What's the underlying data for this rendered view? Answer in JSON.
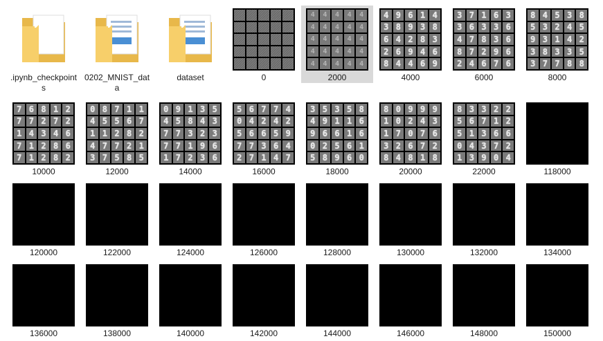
{
  "folders": [
    {
      "label": ".ipynb_checkpoints",
      "icon": "folder-icon"
    },
    {
      "label": "0202_MNIST_data",
      "icon": "folder-icon"
    },
    {
      "label": "dataset",
      "icon": "folder-icon"
    }
  ],
  "images": [
    {
      "label": "0",
      "kind": "noise"
    },
    {
      "label": "2000",
      "kind": "faint",
      "digits": "4444444444444444444444444",
      "selected": true
    },
    {
      "label": "4000",
      "kind": "digits",
      "digits": "4961438938642832694684469"
    },
    {
      "label": "6000",
      "kind": "digits",
      "digits": "3716336336478368729624676"
    },
    {
      "label": "8000",
      "kind": "digits",
      "digits": "8453853245931423833537788"
    },
    {
      "label": "10000",
      "kind": "digits",
      "digits": "7681277272143467128671282"
    },
    {
      "label": "12000",
      "kind": "digits",
      "digits": "0871145567112824772137585"
    },
    {
      "label": "14000",
      "kind": "digits",
      "digits": "0913545843773237719617236"
    },
    {
      "label": "16000",
      "kind": "digits",
      "digits": "5677404242566597736427147"
    },
    {
      "label": "18000",
      "kind": "digits",
      "digits": "3535849116966160256158960"
    },
    {
      "label": "20000",
      "kind": "digits",
      "digits": "8099910243170763267284818"
    },
    {
      "label": "22000",
      "kind": "digits",
      "digits": "8332256712513660437213904"
    },
    {
      "label": "118000",
      "kind": "black"
    },
    {
      "label": "120000",
      "kind": "black"
    },
    {
      "label": "122000",
      "kind": "black"
    },
    {
      "label": "124000",
      "kind": "black"
    },
    {
      "label": "126000",
      "kind": "black"
    },
    {
      "label": "128000",
      "kind": "black"
    },
    {
      "label": "130000",
      "kind": "black"
    },
    {
      "label": "132000",
      "kind": "black"
    },
    {
      "label": "134000",
      "kind": "black"
    },
    {
      "label": "136000",
      "kind": "black"
    },
    {
      "label": "138000",
      "kind": "black"
    },
    {
      "label": "140000",
      "kind": "black"
    },
    {
      "label": "142000",
      "kind": "black"
    },
    {
      "label": "144000",
      "kind": "black"
    },
    {
      "label": "146000",
      "kind": "black"
    },
    {
      "label": "148000",
      "kind": "black"
    },
    {
      "label": "150000",
      "kind": "black"
    }
  ],
  "colors": {
    "folder_back": "#e8b84a",
    "folder_front": "#f7cf6a",
    "selection": "#d9d9d9"
  }
}
